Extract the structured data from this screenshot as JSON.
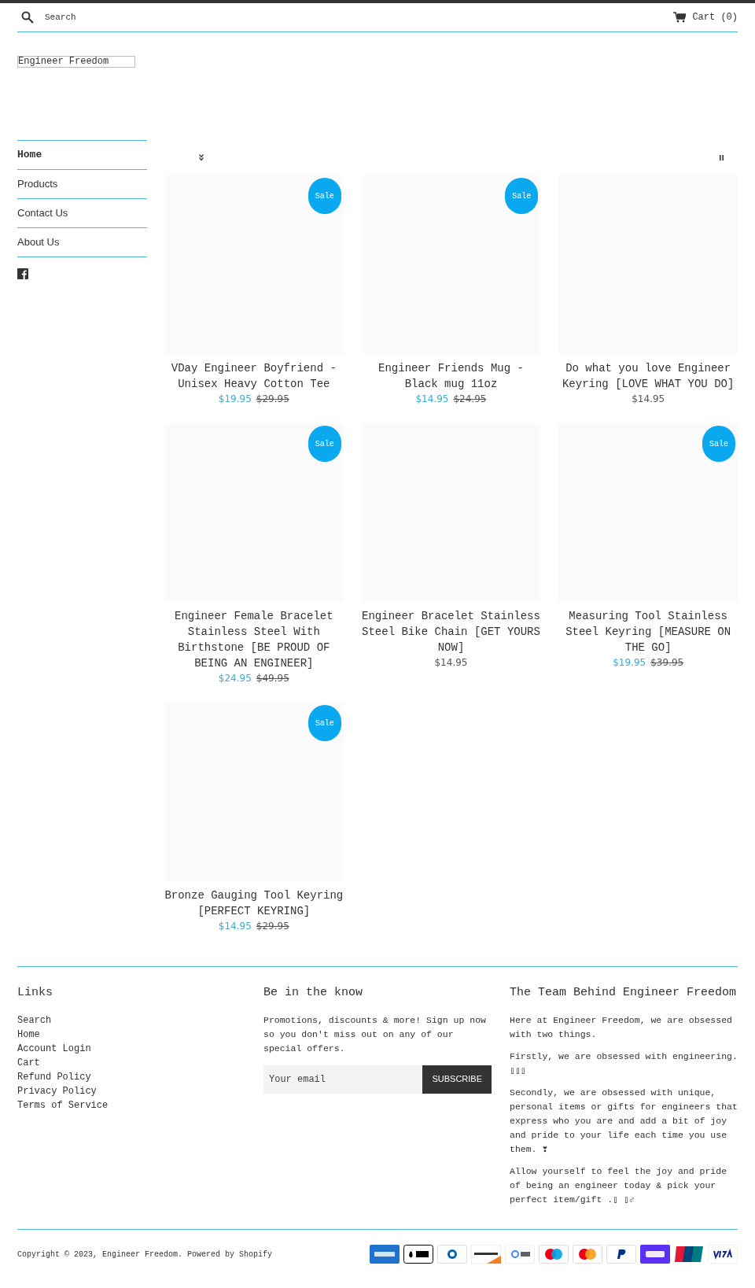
{
  "header": {
    "search_placeholder": "Search",
    "cart": "Cart (0)"
  },
  "logo": "Engineer Freedom",
  "nav": [
    {
      "label": "Home",
      "selected": true
    },
    {
      "label": "Products",
      "selected": false
    },
    {
      "label": "Contact Us",
      "selected": false
    },
    {
      "label": "About Us",
      "selected": false
    }
  ],
  "products": [
    {
      "title": "VDay Engineer Boyfriend - Unisex Heavy Cotton Tee",
      "sale": true,
      "badge": "Sale",
      "price": "$19.95",
      "compare_price": "$29.95"
    },
    {
      "title": "Engineer Friends Mug - Black mug 11oz",
      "sale": true,
      "badge": "Sale",
      "price": "$14.95",
      "compare_price": "$24.95"
    },
    {
      "title": "Do what you love Engineer Keyring [LOVE WHAT YOU DO]",
      "sale": false,
      "price": "$14.95"
    },
    {
      "title": "Engineer Female Bracelet Stainless Steel With Birthstone [BE PROUD OF BEING AN ENGINEER]",
      "sale": true,
      "badge": "Sale",
      "price": "$24.95",
      "compare_price": "$49.95"
    },
    {
      "title": "Engineer Bracelet Stainless Steel Bike Chain [GET YOURS NOW]",
      "sale": false,
      "price": "$14.95"
    },
    {
      "title": "Measuring Tool Stainless Steel Keyring [MEASURE ON THE GO]",
      "sale": true,
      "badge": "Sale",
      "price": "$19.95",
      "compare_price": "$39.95"
    },
    {
      "title": "Bronze Gauging Tool Keyring [PERFECT KEYRING]",
      "sale": true,
      "badge": "Sale",
      "price": "$14.95",
      "compare_price": "$29.95"
    }
  ],
  "footer": {
    "links_title": "Links",
    "links": [
      "Search",
      "Home",
      "Account Login",
      "Cart",
      "Refund Policy",
      "Privacy Policy",
      "Terms of Service"
    ],
    "newsletter_title": "Be in the know",
    "newsletter_text": "Promotions, discounts & more! Sign up now so you don't miss out on any of our special offers.",
    "email_placeholder": "Your email",
    "subscribe": "SUBSCRIBE",
    "about_title": "The Team Behind Engineer Freedom",
    "about_paragraphs": [
      "Here at Engineer Freedom, we are obsessed with two things.",
      "Firstly, we are obsessed with engineering. ▯▯▯",
      "Secondly, we are obsessed with unique, personal items or gifts for engineers that express who you are and add a bit of joy and pride to your life each time you use them. ❣",
      "Allow yourself to feel the joy and pride of being an engineer today & pick your perfect item/gift .▯ ▯♂"
    ],
    "copyright": "Copyright © 2023, Engineer Freedom. Powered by Shopify"
  }
}
